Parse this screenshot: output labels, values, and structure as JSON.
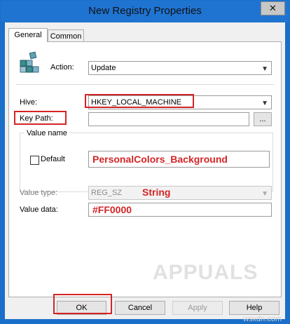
{
  "window": {
    "title": "New Registry Properties",
    "close_glyph": "✕"
  },
  "tabs": [
    {
      "label": "General"
    },
    {
      "label": "Common"
    }
  ],
  "form": {
    "action_label": "Action:",
    "action_value": "Update",
    "hive_label": "Hive:",
    "hive_value": "HKEY_LOCAL_MACHINE",
    "key_path_label": "Key Path:",
    "key_path_value": "",
    "browse_label": "...",
    "value_name_group": "Value name",
    "default_label": "Default",
    "default_checked": false,
    "value_name_value": "PersonalColors_Background",
    "value_type_label": "Value type:",
    "value_type_value": "REG_SZ",
    "value_type_annotation": "String",
    "value_data_label": "Value data:",
    "value_data_value": "#FF0000"
  },
  "buttons": {
    "ok": "OK",
    "cancel": "Cancel",
    "apply": "Apply",
    "help": "Help"
  },
  "watermark": {
    "brand": "APPUALS",
    "site": "wsxdn.com"
  },
  "colors": {
    "annotation_red": "#d42426",
    "title_bar": "#1f74d2"
  },
  "icons": {
    "registry": "registry-cubes-icon",
    "dropdown": "chevron-down-icon"
  }
}
